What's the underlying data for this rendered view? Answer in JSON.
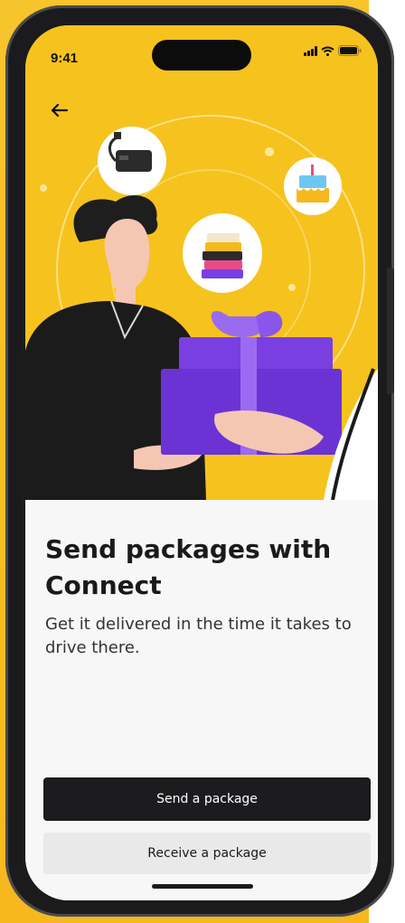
{
  "status_bar": {
    "time": "9:41"
  },
  "nav": {
    "back_icon": "arrow-left-icon"
  },
  "hero": {
    "background": "#f6c21e",
    "bubbles": [
      {
        "icon": "power-adapter-icon"
      },
      {
        "icon": "books-icon"
      },
      {
        "icon": "cake-icon"
      }
    ],
    "illustration": "person-handing-gift-box"
  },
  "content": {
    "title": "Send packages with Connect",
    "subtitle": "Get it delivered in the time it takes to drive there."
  },
  "actions": {
    "send_label": "Send a package",
    "receive_label": "Receive a package"
  },
  "colors": {
    "accent_yellow": "#f7c42c",
    "primary_button": "#1c1c1e",
    "secondary_button": "#e9e9ea",
    "gift_purple": "#7a3fe0"
  }
}
